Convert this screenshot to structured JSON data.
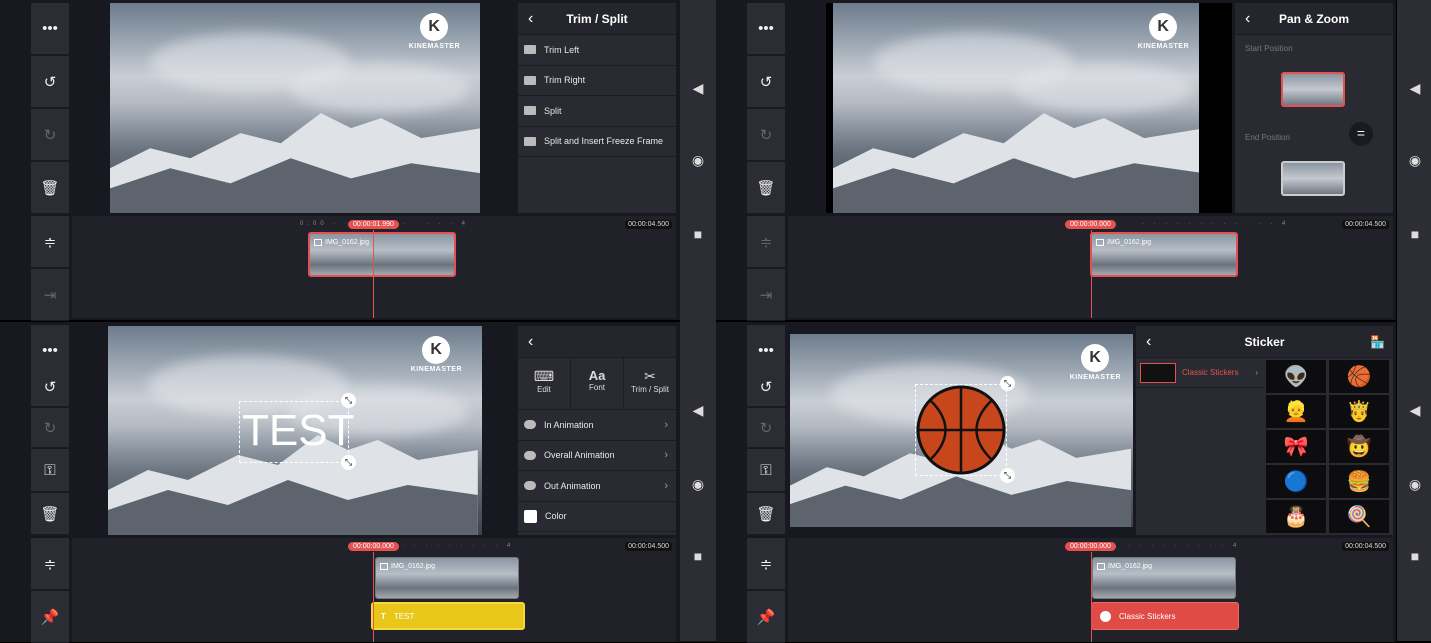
{
  "quadrants": [
    {
      "id": "trim-split",
      "sidebar": [
        "more-icon",
        "undo-icon",
        "redo-icon",
        "delete-icon"
      ],
      "timeline_sidebar": [
        "timeline-adjust-icon",
        "jump-icon"
      ],
      "panel": {
        "title": "Trim / Split",
        "items": [
          {
            "label": "Trim Left",
            "icon": "trim-left-icon"
          },
          {
            "label": "Trim Right",
            "icon": "trim-right-icon"
          },
          {
            "label": "Split",
            "icon": "split-icon"
          },
          {
            "label": "Split and Insert Freeze Frame",
            "icon": "freeze-frame-icon"
          }
        ]
      },
      "timeline": {
        "current_time": "00:00:01.990",
        "end_time": "00:00:04.500",
        "tick_start": "0:00",
        "tick_end": "4",
        "clip_label": "IMG_0162.jpg"
      },
      "watermark": "KINEMASTER"
    },
    {
      "id": "pan-zoom",
      "sidebar": [
        "more-icon",
        "undo-icon",
        "redo-icon",
        "delete-icon"
      ],
      "timeline_sidebar": [
        "timeline-adjust-icon",
        "jump-icon"
      ],
      "panel": {
        "title": "Pan & Zoom",
        "start_label": "Start Position",
        "end_label": "End Position",
        "equal_label": "="
      },
      "timeline": {
        "current_time": "00:00:00.000",
        "end_time": "00:00:04.500",
        "tick_end": "4",
        "clip_label": "IMG_0162.jpg"
      },
      "watermark": "KINEMASTER"
    },
    {
      "id": "text-layer",
      "sidebar": [
        "more-icon",
        "undo-icon",
        "redo-icon",
        "key-icon",
        "delete-icon"
      ],
      "timeline_sidebar": [
        "timeline-adjust-icon",
        "pin-icon"
      ],
      "overlay_text": "TEST",
      "panel": {
        "tabs": [
          {
            "label": "Edit",
            "icon": "keyboard-icon"
          },
          {
            "label": "Font",
            "icon": "font-icon"
          },
          {
            "label": "Trim / Split",
            "icon": "scissors-icon"
          }
        ],
        "items": [
          {
            "label": "In Animation",
            "icon": "in-animation-icon"
          },
          {
            "label": "Overall Animation",
            "icon": "overall-animation-icon"
          },
          {
            "label": "Out Animation",
            "icon": "out-animation-icon"
          },
          {
            "label": "Color",
            "icon": "color-swatch-icon"
          }
        ]
      },
      "timeline": {
        "current_time": "00:00:00.000",
        "end_time": "00:00:04.500",
        "tick_end": "4",
        "clip_label": "IMG_0162.jpg",
        "layer_label": "TEST",
        "layer_color": "#e8c61a"
      },
      "watermark": "KINEMASTER"
    },
    {
      "id": "sticker",
      "sidebar": [
        "more-icon",
        "undo-icon",
        "redo-icon",
        "key-icon",
        "delete-icon"
      ],
      "timeline_sidebar": [
        "timeline-adjust-icon",
        "pin-icon"
      ],
      "panel": {
        "title": "Sticker",
        "category": "Classic Stickers",
        "store_icon": "store-icon",
        "stickers": [
          "alien",
          "basketball",
          "blonde-wig",
          "crown-guy",
          "bow",
          "hat",
          "bowling-ball",
          "burger",
          "cake",
          "lollipop"
        ]
      },
      "timeline": {
        "current_time": "00:00:00.000",
        "end_time": "00:00:04.500",
        "tick_end": "4",
        "clip_label": "IMG_0162.jpg",
        "layer_label": "Classic Stickers",
        "layer_color": "#e14b46"
      },
      "watermark": "KINEMASTER"
    }
  ],
  "right_rail": [
    "back-triangle-icon",
    "home-circle-icon",
    "recents-square-icon"
  ],
  "colors": {
    "accent": "#e55151",
    "panel": "#2a2b32",
    "sidebar": "#2c2d34",
    "background": "#181920"
  }
}
